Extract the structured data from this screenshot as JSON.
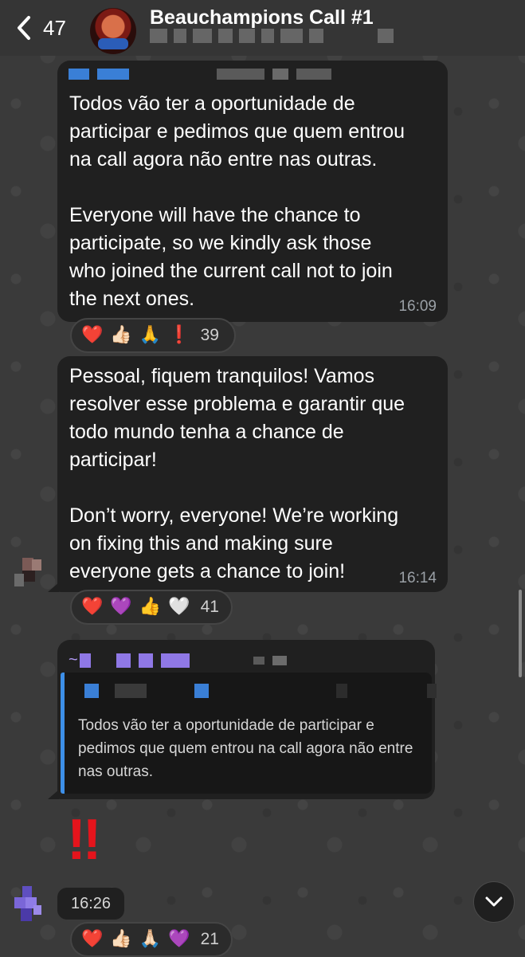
{
  "header": {
    "back_count": "47",
    "title": "Beauchampions Call #1",
    "icons": {
      "back": "chevron-left-icon",
      "avatar": "group-avatar"
    }
  },
  "messages": [
    {
      "text": "Todos vão ter a oportunidade de\nparticipar e pedimos que quem entrou\nna call agora não entre nas outras.\n\nEveryone will have the chance to\nparticipate, so we kindly ask those\nwho joined the current call not to join\nthe next ones.",
      "time": "16:09",
      "reactions": {
        "emojis": [
          "❤️",
          "👍🏻",
          "🙏",
          "❗"
        ],
        "count": "39"
      }
    },
    {
      "text": "Pessoal, fiquem tranquilos! Vamos\nresolver esse problema e garantir que\ntodo mundo tenha a chance de\nparticipar!\n\nDon’t worry, everyone! We’re working\non fixing this and making sure\neveryone gets a chance to join!",
      "time": "16:14",
      "reactions": {
        "emojis": [
          "❤️",
          "💜",
          "👍",
          "🤍"
        ],
        "count": "41"
      }
    },
    {
      "sender_prefix": "~",
      "quote_text": "Todos vão ter a oportunidade de participar e pedimos que quem entrou na call agora não entre nas outras.",
      "body": "‼",
      "time": "16:26",
      "reactions": {
        "emojis": [
          "❤️",
          "👍🏻",
          "🙏🏻",
          "💜"
        ],
        "count": "21"
      }
    }
  ],
  "colors": {
    "background": "#3b3b3b",
    "bubble": "#202020",
    "quote_accent": "#3d8fe8",
    "bang": "#e5141c"
  }
}
